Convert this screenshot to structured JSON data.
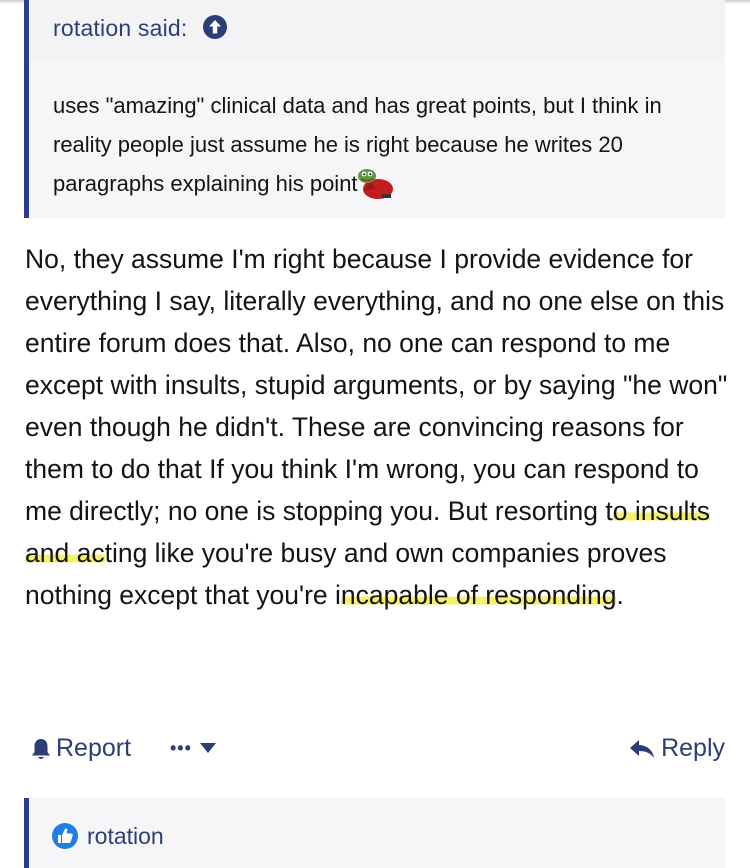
{
  "quote": {
    "author": "rotation said:",
    "text": "uses \"amazing\" clinical data and has great points, but I think in reality people just assume he is right because he writes 20 paragraphs explaining his point",
    "up_icon": "arrow-up-circle-icon",
    "emoji_icon": "pepe-emoji-icon"
  },
  "post": {
    "text_1": "No, they assume I'm right because I provide evidence for everything I say, literally everything, and no one else on this entire forum does that. Also, no one can respond to me except with insults, stupid arguments, or by saying \"he won\" even though he didn't. These are convincing reasons for them to do that If you think I'm wrong, you can respond to me directly; no one is stopping you. But resorting t",
    "highlight_1": "o insults and ac",
    "text_2": "ting like you're busy and own companies proves nothing except that you're i",
    "highlight_2": "ncapable of responding",
    "text_3": ".",
    "highlight_color": "#f4f06a"
  },
  "actions": {
    "report_label": "Report",
    "more_label": "•••",
    "reply_label": "Reply"
  },
  "next_quote": {
    "author": "rotation",
    "icon": "thumbs-up-icon"
  },
  "colors": {
    "accent": "#2b3d8f",
    "link": "#2d3e77",
    "quote_bg": "#f6f6f8"
  }
}
